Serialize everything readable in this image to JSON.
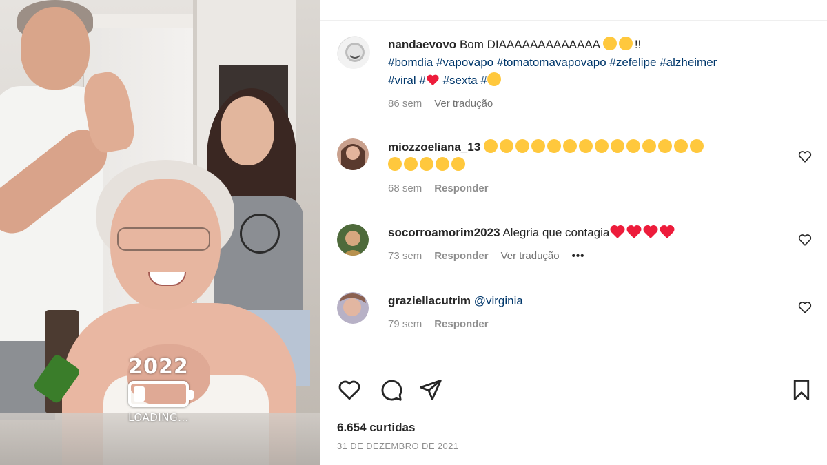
{
  "post": {
    "sticker": {
      "year": "2022",
      "loading_text": "LOADING...",
      "battery_level": 0.22
    },
    "caption": {
      "username": "nandaevovo",
      "text_start": "Bom DIAAAAAAAAAAAAA",
      "text_end": "!!",
      "hashtags_line1": [
        "#bomdia",
        "#vapovapo",
        "#tomatomavapovapo",
        "#zefelipe",
        "#alzheimer"
      ],
      "hashtags_line2_a": "#viral",
      "hashtag_hash_1": "#",
      "hashtags_line2_b": "#sexta",
      "hashtag_hash_2": "#",
      "time": "86 sem",
      "translate": "Ver tradução"
    },
    "comments": [
      {
        "username": "miozzoeliana_13",
        "text": "",
        "time": "68 sem",
        "reply": "Responder"
      },
      {
        "username": "socorroamorim2023",
        "text": "Alegria que contagia",
        "time": "73 sem",
        "reply": "Responder",
        "translate": "Ver tradução",
        "more": "•••"
      },
      {
        "username": "graziellacutrim",
        "mention": "@virginia",
        "time": "79 sem",
        "reply": "Responder"
      }
    ],
    "likes_text": "6.654 curtidas",
    "date_text": "31 DE DEZEMBRO DE 2021",
    "icons": {
      "like": "heart-outline-icon",
      "comment": "comment-bubble-icon",
      "share": "paper-plane-icon",
      "save": "bookmark-icon"
    },
    "colors": {
      "hashtag": "#00376b",
      "muted": "#8e8e8e",
      "heart_red": "#ed1c3b"
    }
  }
}
